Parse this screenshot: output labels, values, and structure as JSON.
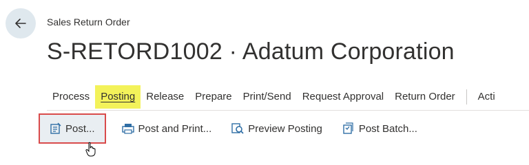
{
  "header": {
    "back_icon": "arrow-left-icon",
    "breadcrumb": "Sales Return Order",
    "title": "S-RETORD1002 · Adatum Corporation"
  },
  "tabs": [
    {
      "label": "Process",
      "active": false
    },
    {
      "label": "Posting",
      "active": true
    },
    {
      "label": "Release",
      "active": false
    },
    {
      "label": "Prepare",
      "active": false
    },
    {
      "label": "Print/Send",
      "active": false
    },
    {
      "label": "Request Approval",
      "active": false
    },
    {
      "label": "Return Order",
      "active": false
    },
    {
      "label": "Acti",
      "active": false
    }
  ],
  "actions": [
    {
      "label": "Post...",
      "icon": "post-icon"
    },
    {
      "label": "Post and Print...",
      "icon": "post-and-print-icon"
    },
    {
      "label": "Preview Posting",
      "icon": "preview-posting-icon"
    },
    {
      "label": "Post Batch...",
      "icon": "post-batch-icon"
    }
  ],
  "colors": {
    "posting_tab_highlight": "#f3f25a",
    "post_button_outline": "#d94a4a",
    "icon_blue": "#2f6ea5"
  }
}
